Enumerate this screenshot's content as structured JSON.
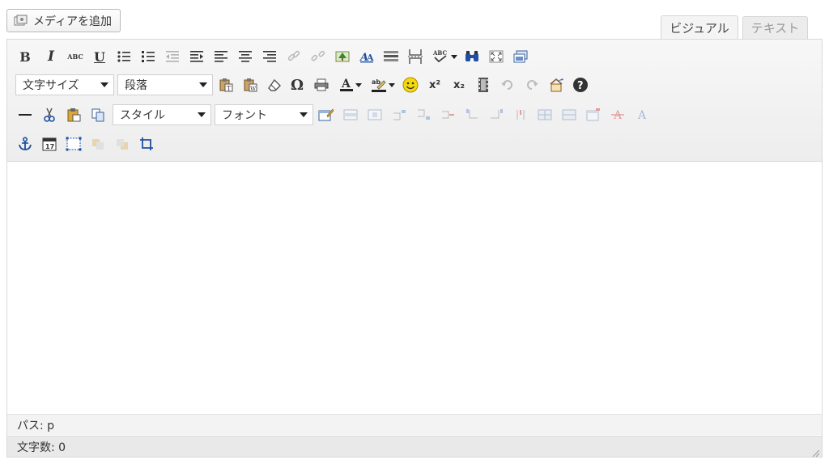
{
  "media_button": {
    "label": "メディアを追加",
    "icon": "media-icon"
  },
  "tabs": {
    "visual": "ビジュアル",
    "text": "テキスト"
  },
  "toolbar": {
    "font_size_select": "文字サイズ",
    "format_select": "段落",
    "style_select": "スタイル",
    "font_select": "フォント",
    "text_glyphs": {
      "bold": "B",
      "italic": "I",
      "strike": "ABC",
      "underline": "U",
      "omega": "Ω",
      "sup": "x²",
      "sub": "x₂",
      "spell": "ABC",
      "charmap": "A"
    }
  },
  "status": {
    "path": "パス: p",
    "word_count": "文字数: 0"
  },
  "colors": {
    "accent_blue": "#2a73c9",
    "toolbar_bg": "#ededed",
    "border": "#d9d9d9",
    "help": "#333333"
  }
}
